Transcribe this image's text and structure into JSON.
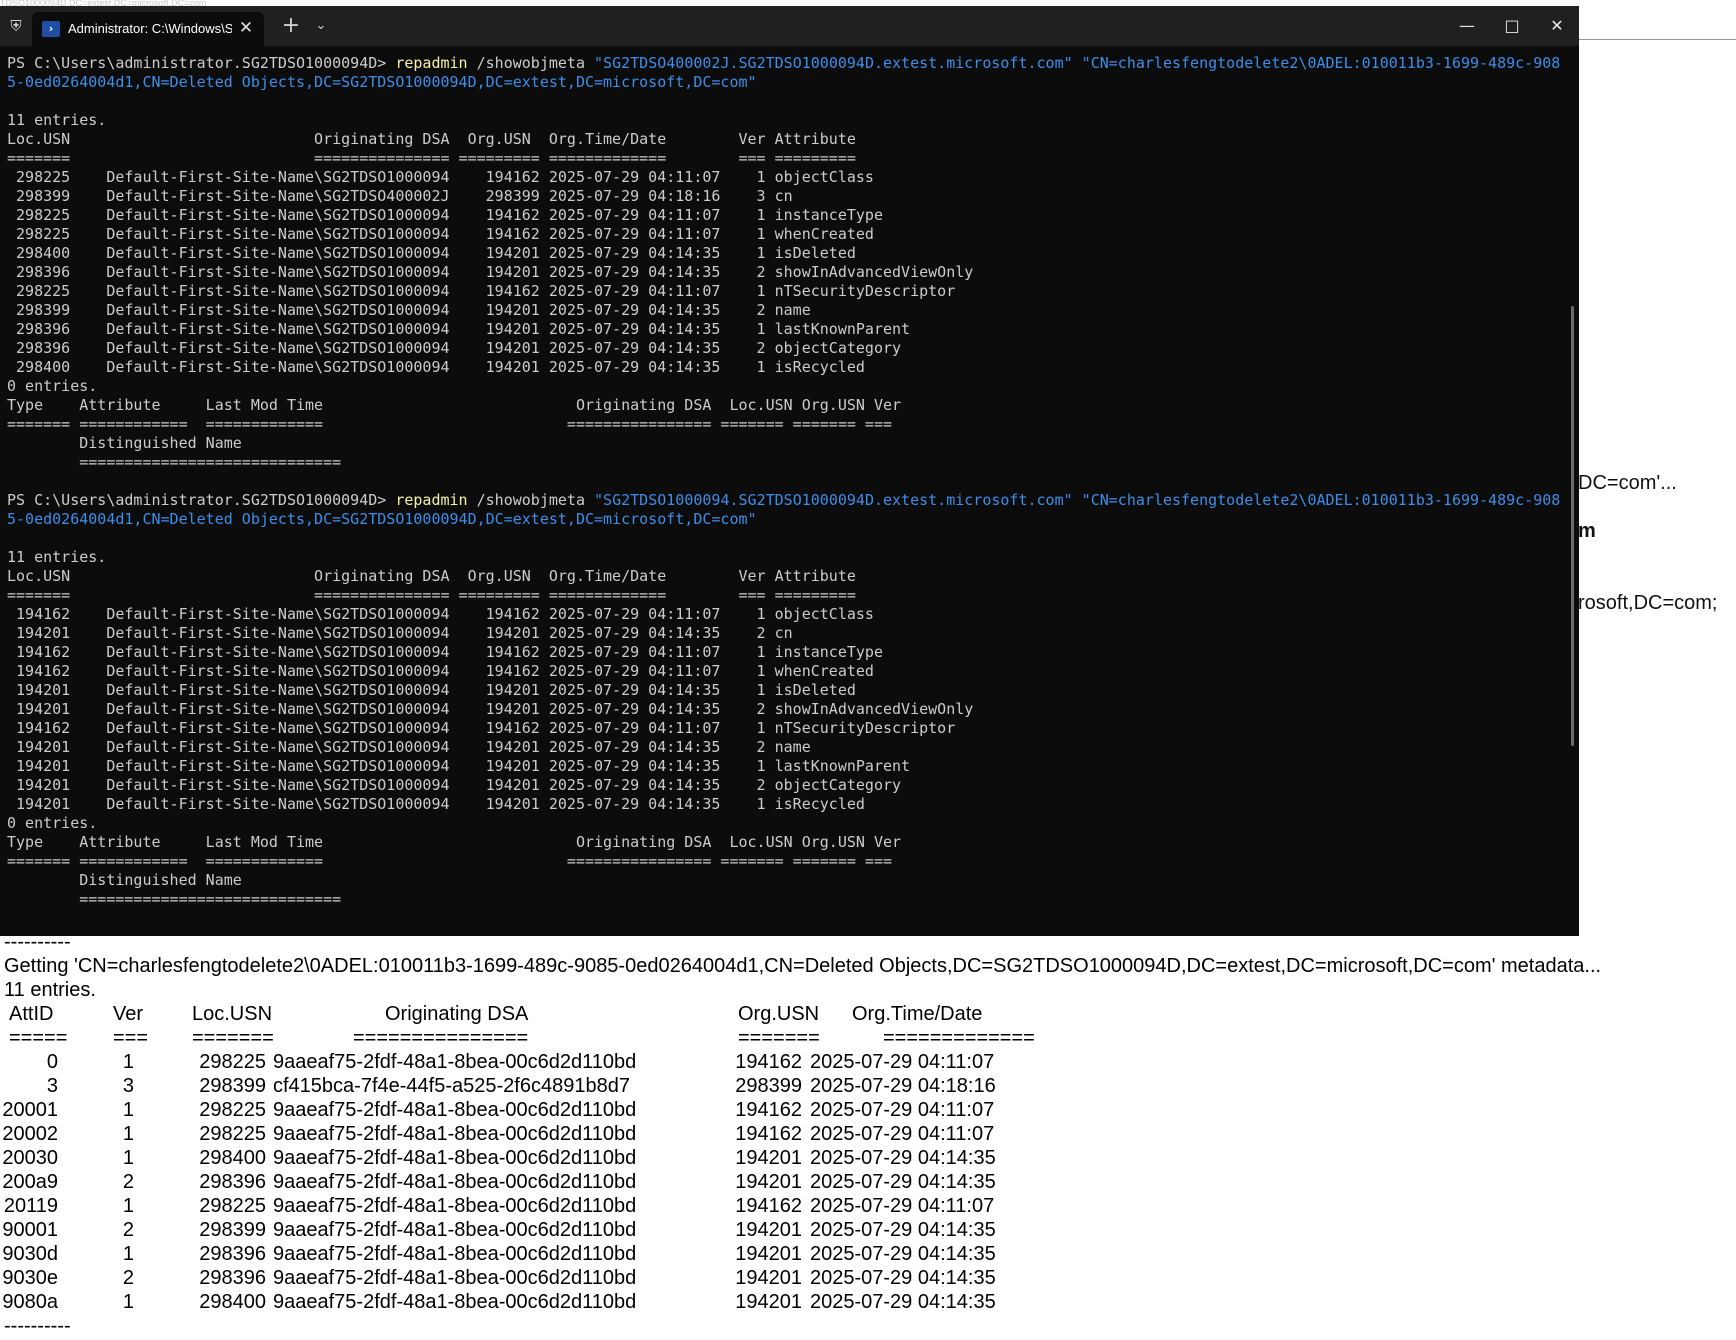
{
  "background": {
    "top_fade_text": "TDSO1000094D.DC=extest,DC=microsoft,DC=com",
    "fragments": [
      "DC=com'...",
      "m",
      "rosoft,DC=com;"
    ]
  },
  "window": {
    "tab_title": "Administrator: C:\\Windows\\Sy",
    "icons": [
      "shield-icon",
      "powershell-icon",
      "close-icon",
      "plus-icon",
      "chevron-down-icon",
      "minimize-icon",
      "maximize-icon",
      "window-close-icon"
    ],
    "colors": {
      "terminal_bg": "#0c0c0c",
      "tabbar_bg": "#202020",
      "text": "#cccccc",
      "command": "#f9f1a5",
      "string": "#3b8eea"
    }
  },
  "terminal": {
    "lines": [
      {
        "parts": [
          {
            "t": "PS C:\\Users\\administrator.SG2TDSO1000094D> "
          },
          {
            "t": "repadmin",
            "c": "yel"
          },
          {
            "t": " /showobjmeta "
          },
          {
            "t": "\"SG2TDSO400002J.SG2TDSO1000094D.extest.microsoft.com\" \"CN=charlesfengtodelete2\\0ADEL:010011b3-1699-489c-908",
            "c": "blu"
          }
        ]
      },
      {
        "parts": [
          {
            "t": "5-0ed0264004d1,CN=Deleted Objects,DC=SG2TDSO1000094D,DC=extest,DC=microsoft,DC=com\"",
            "c": "blu"
          }
        ]
      },
      {
        "parts": [
          {
            "t": ""
          }
        ]
      },
      {
        "parts": [
          {
            "t": "11 entries."
          }
        ]
      },
      {
        "parts": [
          {
            "t": "Loc.USN                           Originating DSA  Org.USN  Org.Time/Date        Ver Attribute"
          }
        ]
      },
      {
        "parts": [
          {
            "t": "=======                           =============== ========= =============        === ========="
          }
        ]
      },
      {
        "parts": [
          {
            "t": " 298225    Default-First-Site-Name\\SG2TDSO1000094    194162 2025-07-29 04:11:07    1 objectClass"
          }
        ]
      },
      {
        "parts": [
          {
            "t": " 298399    Default-First-Site-Name\\SG2TDSO400002J    298399 2025-07-29 04:18:16    3 cn"
          }
        ]
      },
      {
        "parts": [
          {
            "t": " 298225    Default-First-Site-Name\\SG2TDSO1000094    194162 2025-07-29 04:11:07    1 instanceType"
          }
        ]
      },
      {
        "parts": [
          {
            "t": " 298225    Default-First-Site-Name\\SG2TDSO1000094    194162 2025-07-29 04:11:07    1 whenCreated"
          }
        ]
      },
      {
        "parts": [
          {
            "t": " 298400    Default-First-Site-Name\\SG2TDSO1000094    194201 2025-07-29 04:14:35    1 isDeleted"
          }
        ]
      },
      {
        "parts": [
          {
            "t": " 298396    Default-First-Site-Name\\SG2TDSO1000094    194201 2025-07-29 04:14:35    2 showInAdvancedViewOnly"
          }
        ]
      },
      {
        "parts": [
          {
            "t": " 298225    Default-First-Site-Name\\SG2TDSO1000094    194162 2025-07-29 04:11:07    1 nTSecurityDescriptor"
          }
        ]
      },
      {
        "parts": [
          {
            "t": " 298399    Default-First-Site-Name\\SG2TDSO1000094    194201 2025-07-29 04:14:35    2 name"
          }
        ]
      },
      {
        "parts": [
          {
            "t": " 298396    Default-First-Site-Name\\SG2TDSO1000094    194201 2025-07-29 04:14:35    1 lastKnownParent"
          }
        ]
      },
      {
        "parts": [
          {
            "t": " 298396    Default-First-Site-Name\\SG2TDSO1000094    194201 2025-07-29 04:14:35    2 objectCategory"
          }
        ]
      },
      {
        "parts": [
          {
            "t": " 298400    Default-First-Site-Name\\SG2TDSO1000094    194201 2025-07-29 04:14:35    1 isRecycled"
          }
        ]
      },
      {
        "parts": [
          {
            "t": "0 entries."
          }
        ]
      },
      {
        "parts": [
          {
            "t": "Type    Attribute     Last Mod Time                            Originating DSA  Loc.USN Org.USN Ver"
          }
        ]
      },
      {
        "parts": [
          {
            "t": "======= ============  =============                           ================ ======= ======= ==="
          }
        ]
      },
      {
        "parts": [
          {
            "t": "        Distinguished Name"
          }
        ]
      },
      {
        "parts": [
          {
            "t": "        ============================="
          }
        ]
      },
      {
        "parts": [
          {
            "t": ""
          }
        ]
      },
      {
        "parts": [
          {
            "t": "PS C:\\Users\\administrator.SG2TDSO1000094D> "
          },
          {
            "t": "repadmin",
            "c": "yel"
          },
          {
            "t": " /showobjmeta "
          },
          {
            "t": "\"SG2TDSO1000094.SG2TDSO1000094D.extest.microsoft.com\" \"CN=charlesfengtodelete2\\0ADEL:010011b3-1699-489c-908",
            "c": "blu"
          }
        ]
      },
      {
        "parts": [
          {
            "t": "5-0ed0264004d1,CN=Deleted Objects,DC=SG2TDSO1000094D,DC=extest,DC=microsoft,DC=com\"",
            "c": "blu"
          }
        ]
      },
      {
        "parts": [
          {
            "t": ""
          }
        ]
      },
      {
        "parts": [
          {
            "t": "11 entries."
          }
        ]
      },
      {
        "parts": [
          {
            "t": "Loc.USN                           Originating DSA  Org.USN  Org.Time/Date        Ver Attribute"
          }
        ]
      },
      {
        "parts": [
          {
            "t": "=======                           =============== ========= =============        === ========="
          }
        ]
      },
      {
        "parts": [
          {
            "t": " 194162    Default-First-Site-Name\\SG2TDSO1000094    194162 2025-07-29 04:11:07    1 objectClass"
          }
        ]
      },
      {
        "parts": [
          {
            "t": " 194201    Default-First-Site-Name\\SG2TDSO1000094    194201 2025-07-29 04:14:35    2 cn"
          }
        ]
      },
      {
        "parts": [
          {
            "t": " 194162    Default-First-Site-Name\\SG2TDSO1000094    194162 2025-07-29 04:11:07    1 instanceType"
          }
        ]
      },
      {
        "parts": [
          {
            "t": " 194162    Default-First-Site-Name\\SG2TDSO1000094    194162 2025-07-29 04:11:07    1 whenCreated"
          }
        ]
      },
      {
        "parts": [
          {
            "t": " 194201    Default-First-Site-Name\\SG2TDSO1000094    194201 2025-07-29 04:14:35    1 isDeleted"
          }
        ]
      },
      {
        "parts": [
          {
            "t": " 194201    Default-First-Site-Name\\SG2TDSO1000094    194201 2025-07-29 04:14:35    2 showInAdvancedViewOnly"
          }
        ]
      },
      {
        "parts": [
          {
            "t": " 194162    Default-First-Site-Name\\SG2TDSO1000094    194162 2025-07-29 04:11:07    1 nTSecurityDescriptor"
          }
        ]
      },
      {
        "parts": [
          {
            "t": " 194201    Default-First-Site-Name\\SG2TDSO1000094    194201 2025-07-29 04:14:35    2 name"
          }
        ]
      },
      {
        "parts": [
          {
            "t": " 194201    Default-First-Site-Name\\SG2TDSO1000094    194201 2025-07-29 04:14:35    1 lastKnownParent"
          }
        ]
      },
      {
        "parts": [
          {
            "t": " 194201    Default-First-Site-Name\\SG2TDSO1000094    194201 2025-07-29 04:14:35    2 objectCategory"
          }
        ]
      },
      {
        "parts": [
          {
            "t": " 194201    Default-First-Site-Name\\SG2TDSO1000094    194201 2025-07-29 04:14:35    1 isRecycled"
          }
        ]
      },
      {
        "parts": [
          {
            "t": "0 entries."
          }
        ]
      },
      {
        "parts": [
          {
            "t": "Type    Attribute     Last Mod Time                            Originating DSA  Loc.USN Org.USN Ver"
          }
        ]
      },
      {
        "parts": [
          {
            "t": "======= ============  =============                           ================ ======= ======= ==="
          }
        ]
      },
      {
        "parts": [
          {
            "t": "        Distinguished Name"
          }
        ]
      },
      {
        "parts": [
          {
            "t": "        ============================="
          }
        ]
      }
    ]
  },
  "output": {
    "separator_top": "----------",
    "getting_line": "Getting 'CN=charlesfengtodelete2\\0ADEL:010011b3-1699-489c-9085-0ed0264004d1,CN=Deleted Objects,DC=SG2TDSO1000094D,DC=extest,DC=microsoft,DC=com' metadata...",
    "entries_line": "11 entries.",
    "headers": [
      "AttID",
      "Ver",
      "Loc.USN",
      "Originating DSA",
      "Org.USN",
      "Org.Time/Date"
    ],
    "underlines": [
      "=====",
      "===",
      "=======",
      "===============",
      "=======",
      "============="
    ],
    "rows": [
      [
        "0",
        "1",
        "298225",
        "9aaeaf75-2fdf-48a1-8bea-00c6d2d110bd",
        "194162",
        "2025-07-29 04:11:07"
      ],
      [
        "3",
        "3",
        "298399",
        "cf415bca-7f4e-44f5-a525-2f6c4891b8d7",
        "298399",
        "2025-07-29 04:18:16"
      ],
      [
        "20001",
        "1",
        "298225",
        "9aaeaf75-2fdf-48a1-8bea-00c6d2d110bd",
        "194162",
        "2025-07-29 04:11:07"
      ],
      [
        "20002",
        "1",
        "298225",
        "9aaeaf75-2fdf-48a1-8bea-00c6d2d110bd",
        "194162",
        "2025-07-29 04:11:07"
      ],
      [
        "20030",
        "1",
        "298400",
        "9aaeaf75-2fdf-48a1-8bea-00c6d2d110bd",
        "194201",
        "2025-07-29 04:14:35"
      ],
      [
        "200a9",
        "2",
        "298396",
        "9aaeaf75-2fdf-48a1-8bea-00c6d2d110bd",
        "194201",
        "2025-07-29 04:14:35"
      ],
      [
        "20119",
        "1",
        "298225",
        "9aaeaf75-2fdf-48a1-8bea-00c6d2d110bd",
        "194162",
        "2025-07-29 04:11:07"
      ],
      [
        "90001",
        "2",
        "298399",
        "9aaeaf75-2fdf-48a1-8bea-00c6d2d110bd",
        "194201",
        "2025-07-29 04:14:35"
      ],
      [
        "9030d",
        "1",
        "298396",
        "9aaeaf75-2fdf-48a1-8bea-00c6d2d110bd",
        "194201",
        "2025-07-29 04:14:35"
      ],
      [
        "9030e",
        "2",
        "298396",
        "9aaeaf75-2fdf-48a1-8bea-00c6d2d110bd",
        "194201",
        "2025-07-29 04:14:35"
      ],
      [
        "9080a",
        "1",
        "298400",
        "9aaeaf75-2fdf-48a1-8bea-00c6d2d110bd",
        "194201",
        "2025-07-29 04:14:35"
      ]
    ],
    "separator_bottom": "----------"
  }
}
